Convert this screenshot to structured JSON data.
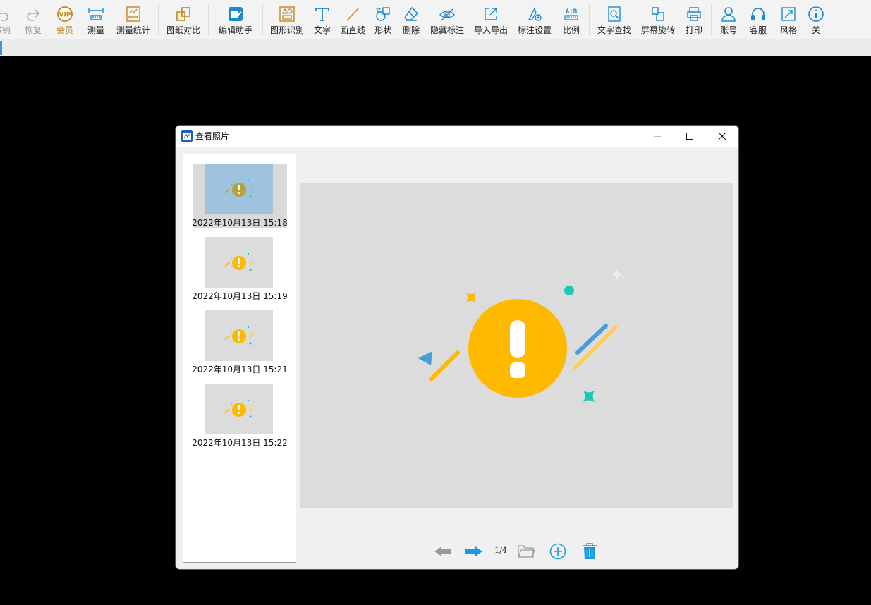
{
  "toolbar": {
    "items": [
      {
        "label": "撤销",
        "icon": "undo-icon",
        "state": "disabled"
      },
      {
        "label": "恢复",
        "icon": "redo-icon",
        "state": "disabled"
      },
      {
        "label": "会员",
        "icon": "vip-icon",
        "state": "vip"
      },
      {
        "label": "测量",
        "icon": "measure-icon"
      },
      {
        "label": "测量统计",
        "icon": "measure-stats-icon"
      },
      {
        "label": "图纸对比",
        "icon": "compare-icon"
      },
      {
        "label": "编辑助手",
        "icon": "edit-assistant-icon"
      },
      {
        "label": "图形识别",
        "icon": "shape-recognition-icon"
      },
      {
        "label": "文字",
        "icon": "text-icon"
      },
      {
        "label": "画直线",
        "icon": "line-icon"
      },
      {
        "label": "形状",
        "icon": "shape-icon"
      },
      {
        "label": "删除",
        "icon": "eraser-icon"
      },
      {
        "label": "隐藏标注",
        "icon": "hide-annotation-icon"
      },
      {
        "label": "导入导出",
        "icon": "import-export-icon"
      },
      {
        "label": "标注设置",
        "icon": "annotation-settings-icon"
      },
      {
        "label": "比例",
        "icon": "scale-icon"
      },
      {
        "label": "文字查找",
        "icon": "text-search-icon"
      },
      {
        "label": "屏幕旋转",
        "icon": "screen-rotate-icon"
      },
      {
        "label": "打印",
        "icon": "print-icon"
      },
      {
        "label": "账号",
        "icon": "account-icon"
      },
      {
        "label": "客服",
        "icon": "customer-service-icon"
      },
      {
        "label": "风格",
        "icon": "style-icon"
      },
      {
        "label": "关",
        "icon": "about-icon"
      }
    ],
    "vip_badge": "VIP",
    "scale_badge": "A:B"
  },
  "dialog": {
    "title": "查看照片",
    "icon": "cad-app-icon",
    "photos": [
      {
        "caption": "2022年10月13日 15:18",
        "selected": true
      },
      {
        "caption": "2022年10月13日 15:19",
        "selected": false
      },
      {
        "caption": "2022年10月13日 15:21",
        "selected": false
      },
      {
        "caption": "2022年10月13日 15:22",
        "selected": false
      }
    ],
    "page_indicator": "1/4",
    "colors": {
      "accent_blue": "#1a9ae0",
      "warning_yellow": "#ffb900",
      "teal": "#1ec8b4",
      "disabled_grey": "#9a9a9a",
      "selected_thumb_bg": "#9fc2de"
    }
  }
}
